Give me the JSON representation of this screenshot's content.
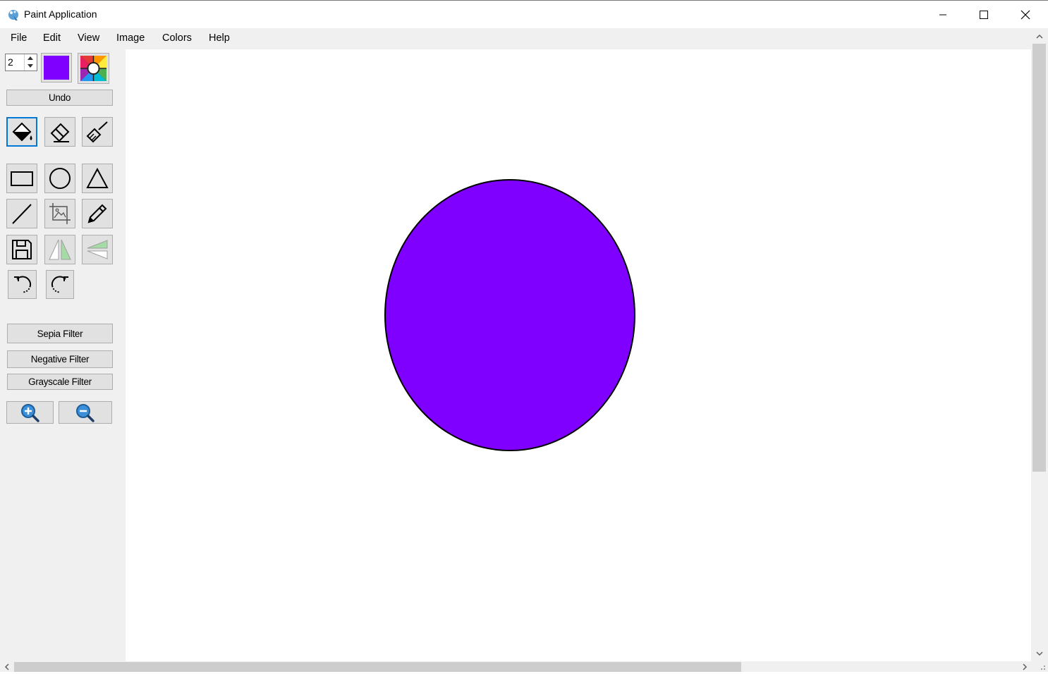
{
  "window": {
    "title": "Paint Application"
  },
  "menu": [
    {
      "label": "File"
    },
    {
      "label": "Edit"
    },
    {
      "label": "View"
    },
    {
      "label": "Image"
    },
    {
      "label": "Colors"
    },
    {
      "label": "Help"
    }
  ],
  "toolbar": {
    "brush_size": "2",
    "current_color": "#8000ff",
    "undo_label": "Undo",
    "filters": {
      "sepia": "Sepia Filter",
      "negative": "Negative Filter",
      "grayscale": "Grayscale Filter"
    },
    "selected_tool": "fill-bucket",
    "tools": [
      "fill-bucket",
      "eraser",
      "brush",
      "rectangle",
      "ellipse",
      "triangle",
      "line",
      "crop-image",
      "pencil",
      "save",
      "flip-vertical",
      "flip-horizontal",
      "rotate-left",
      "rotate-right",
      "zoom-in",
      "zoom-out"
    ]
  },
  "canvas": {
    "shapes": [
      {
        "type": "ellipse",
        "fill": "#8000ff",
        "stroke": "#000000"
      }
    ]
  },
  "colors": {
    "accent": "#0078d7",
    "panel": "#f0f0f0",
    "button": "#e1e1e1"
  }
}
